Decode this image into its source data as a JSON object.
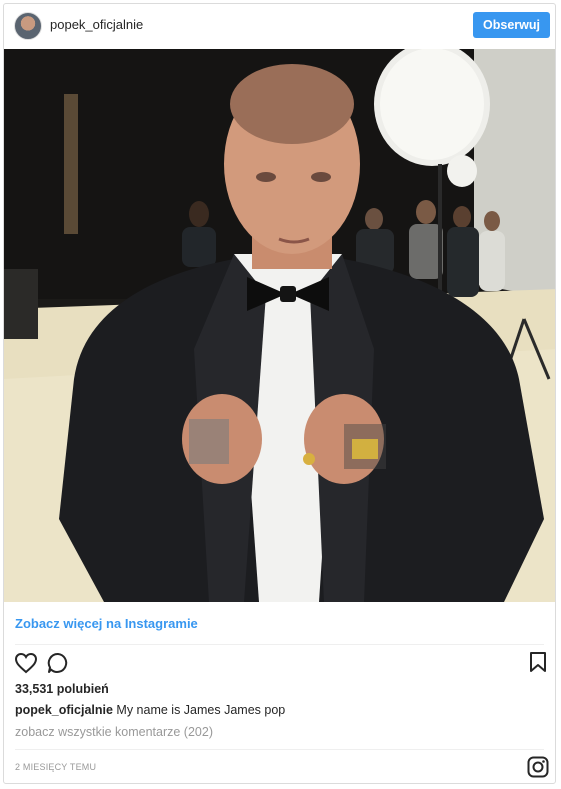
{
  "header": {
    "username": "popek_oficjalnie",
    "follow_label": "Obserwuj"
  },
  "post": {
    "image_icon": "photo"
  },
  "see_more": "Zobacz więcej na Instagramie",
  "actions": {
    "like_icon": "heart-icon",
    "comment_icon": "comment-icon",
    "save_icon": "bookmark-icon"
  },
  "likes": "33,531 polubień",
  "caption": {
    "user": "popek_oficjalnie",
    "text": " My name is James James pop"
  },
  "comments_link": "zobacz wszystkie komentarze (202)",
  "time": "2 MIESIĘCY TEMU",
  "footer": {
    "logo_icon": "instagram-icon"
  },
  "colors": {
    "accent": "#3897f0",
    "muted": "#999999",
    "text": "#262626"
  }
}
